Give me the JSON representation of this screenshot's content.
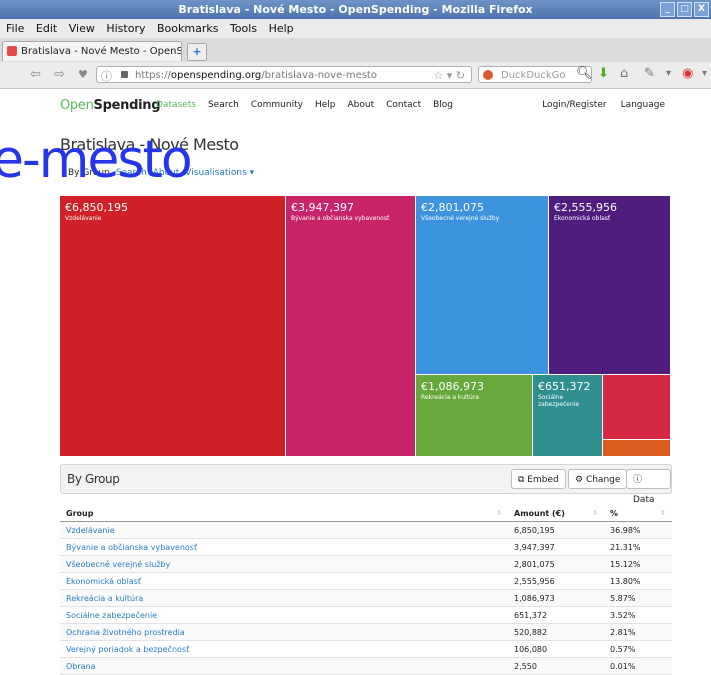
{
  "window": {
    "title": "Bratislava - Nové Mesto - OpenSpending - Mozilla Firefox",
    "controls": [
      "_",
      "□",
      "X"
    ]
  },
  "menu": [
    "File",
    "Edit",
    "View",
    "History",
    "Bookmarks",
    "Tools",
    "Help"
  ],
  "browser": {
    "tab_title": "Bratislava - Nové Mesto - OpenSp...",
    "new_tab": "+",
    "url_prefix": "https://",
    "url_host": "openspending.org",
    "url_path": "/bratislava-nove-mesto",
    "search_placeholder": "DuckDuckGo"
  },
  "site": {
    "logo_open": "Open",
    "logo_spending": "Spending",
    "nav": [
      "Datasets",
      "Search",
      "Community",
      "Help",
      "About",
      "Contact",
      "Blog"
    ],
    "nav_right": [
      "Login/Register",
      "Language"
    ]
  },
  "page": {
    "title": "Bratislava - Nové Mesto",
    "slug_overlay": "e-mesto",
    "subtabs": [
      "By Group",
      "Search",
      "About",
      "Visualisations ▾"
    ]
  },
  "treemap": [
    {
      "amount": "€6,850,195",
      "name": "Vzdelávanie",
      "color": "#cf2127"
    },
    {
      "amount": "€3,947,397",
      "name": "Bývanie a občianska vybavenosť",
      "color": "#c72469"
    },
    {
      "amount": "€2,801,075",
      "name": "Všeobecné verejné služby",
      "color": "#3d93de"
    },
    {
      "amount": "€2,555,956",
      "name": "Ekonomická oblasť",
      "color": "#4e1d7e"
    },
    {
      "amount": "€1,086,973",
      "name": "Rekreácia a kultúra",
      "color": "#66a83b"
    },
    {
      "amount": "€651,372",
      "name": "Sociálne zabezpečenie",
      "color": "#2f8f8f"
    },
    {
      "amount": "",
      "name": "",
      "color": "#d42844"
    },
    {
      "amount": "",
      "name": "",
      "color": "#d85d1f"
    }
  ],
  "table": {
    "heading": "By Group",
    "buttons": [
      "Embed",
      "Change",
      "Data"
    ],
    "columns": [
      "Group",
      "Amount (€)",
      "%"
    ],
    "rows": [
      {
        "group": "Vzdelávanie",
        "amount": "6,850,195",
        "pct": "36.98%"
      },
      {
        "group": "Bývanie a občianska vybavenosť",
        "amount": "3,947,397",
        "pct": "21.31%"
      },
      {
        "group": "Všeobecné verejné služby",
        "amount": "2,801,075",
        "pct": "15.12%"
      },
      {
        "group": "Ekonomická oblasť",
        "amount": "2,555,956",
        "pct": "13.80%"
      },
      {
        "group": "Rekreácia a kultúra",
        "amount": "1,086,973",
        "pct": "5.87%"
      },
      {
        "group": "Sociálne zabezpečenie",
        "amount": "651,372",
        "pct": "3.52%"
      },
      {
        "group": "Ochrana životného prostredia",
        "amount": "520,882",
        "pct": "2.81%"
      },
      {
        "group": "Verejný poriadok a bezpečnosť",
        "amount": "106,080",
        "pct": "0.57%"
      },
      {
        "group": "Obrana",
        "amount": "2,550",
        "pct": "0.01%"
      }
    ]
  }
}
